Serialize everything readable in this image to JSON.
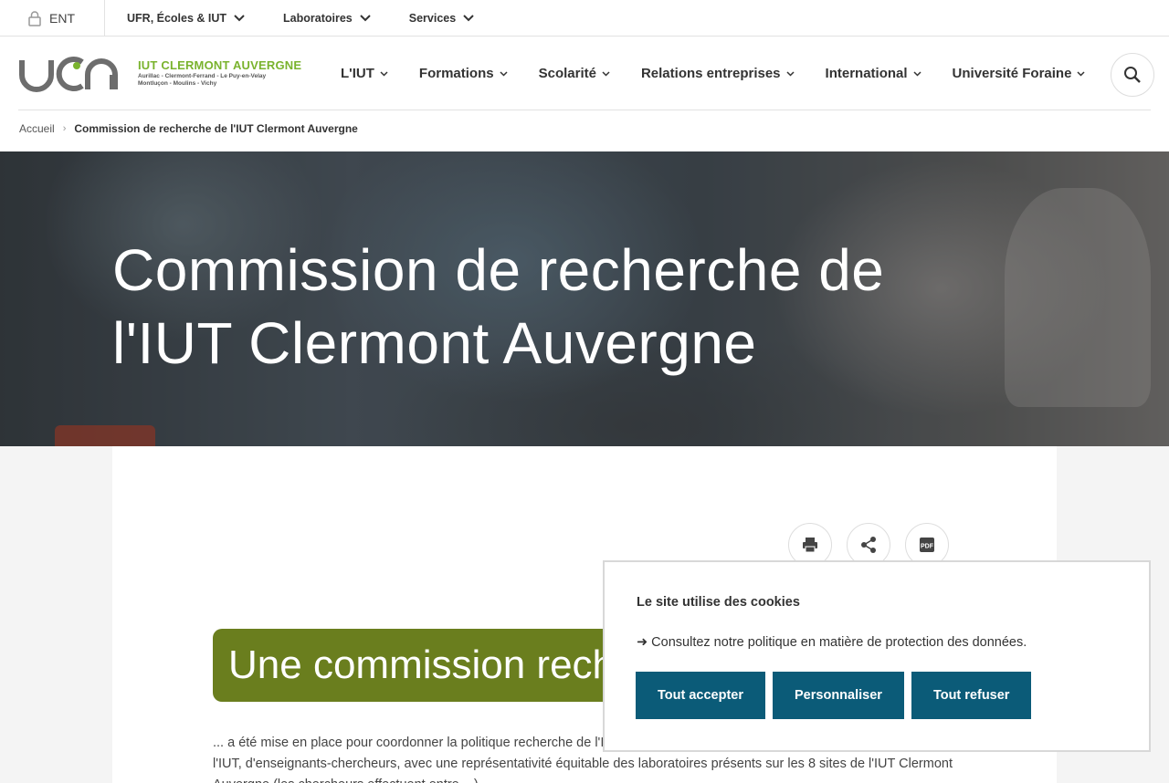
{
  "topbar": {
    "ent_label": "ENT",
    "links": [
      "UFR, Écoles & IUT",
      "Laboratoires",
      "Services"
    ]
  },
  "logo": {
    "title": "IUT CLERMONT AUVERGNE",
    "sub1": "Aurillac - Clermont-Ferrand - Le Puy-en-Velay",
    "sub2": "Montluçon - Moulins - Vichy",
    "accent": "#7ab32e"
  },
  "nav": {
    "items": [
      "L'IUT",
      "Formations",
      "Scolarité",
      "Relations entreprises",
      "International",
      "Université Foraine"
    ]
  },
  "breadcrumb": {
    "home": "Accueil",
    "separator": "›",
    "current": "Commission de recherche de l'IUT Clermont Auvergne"
  },
  "hero": {
    "title": "Commission de recherche de l'IUT Clermont Auvergne"
  },
  "tools": {
    "print_icon": "print-icon",
    "share_icon": "share-icon",
    "pdf_label": "PDF"
  },
  "content": {
    "banner": "Une commission recherche",
    "paragraph": "... a été mise en place pour coordonner la politique recherche de l'IUT Clermont Auvergne. Elle est constituée du directeur de l'IUT, d'enseignants-chercheurs, avec une représentativité équitable des laboratoires présents sur les 8 sites de l'IUT Clermont Auvergne (les chercheurs effectuent entre ...)",
    "banner_color": "#6a7e1e"
  },
  "cookie": {
    "title": "Le site utilise des cookies",
    "policy": "➜ Consultez notre politique en matière de protection des données.",
    "accept": "Tout accepter",
    "customize": "Personnaliser",
    "refuse": "Tout refuser",
    "button_color": "#0b5b78"
  }
}
